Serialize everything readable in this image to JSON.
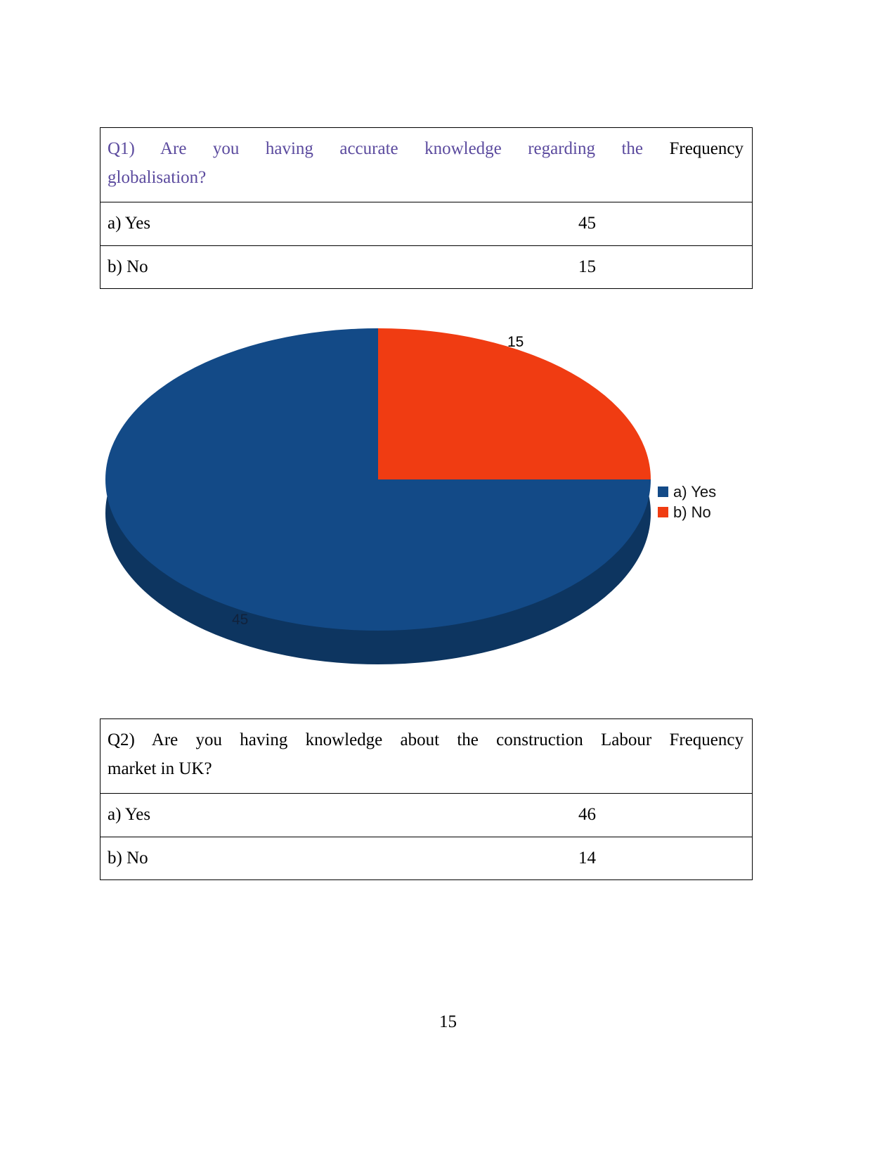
{
  "document": {
    "page_number": "15"
  },
  "tables": [
    {
      "id": "q1",
      "question_prefix": "Q1)  Are  you  having  accurate  knowledge  regarding  the",
      "question_secondline": "globalisation?",
      "question_color": "#5b4a9e",
      "frequency_header": "Frequency",
      "rows": [
        {
          "option": "a) Yes",
          "value": "45"
        },
        {
          "option": "b) No",
          "value": "15"
        }
      ]
    },
    {
      "id": "q2",
      "question_prefix": "Q2)  Are  you  having  knowledge  about  the  construction  Labour",
      "question_secondline": "market in UK?",
      "question_color": "#000000",
      "frequency_header": "Frequency",
      "rows": [
        {
          "option": "a) Yes",
          "value": "46"
        },
        {
          "option": "b) No",
          "value": "14"
        }
      ]
    }
  ],
  "chart_data": {
    "type": "pie",
    "title": "",
    "three_d": true,
    "categories": [
      "a) Yes",
      "b) No"
    ],
    "values": [
      45,
      15
    ],
    "percentages": [
      75,
      25
    ],
    "colors": [
      "#134a87",
      "#f03c12"
    ],
    "side_colors": [
      "#0d3560",
      "#c42f0d"
    ],
    "data_labels": [
      "45",
      "15"
    ],
    "legend": {
      "position": "right",
      "entries": [
        {
          "label": "a) Yes",
          "color": "#134a87"
        },
        {
          "label": "b) No",
          "color": "#f03c12"
        }
      ]
    }
  }
}
